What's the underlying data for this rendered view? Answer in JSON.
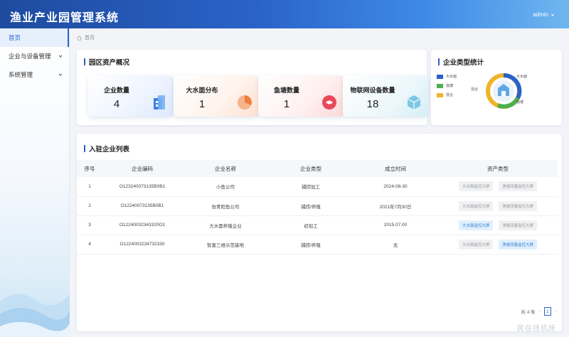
{
  "app": {
    "title": "渔业产业园管理系统",
    "user": "admin"
  },
  "sidebar": {
    "items": [
      {
        "label": "首页"
      },
      {
        "label": "企业与设备管理"
      },
      {
        "label": "系统管理"
      }
    ]
  },
  "breadcrumb": "首页",
  "overview": {
    "title": "园区资产概况",
    "stats": [
      {
        "label": "企业数量",
        "value": "4",
        "icon": "building-icon"
      },
      {
        "label": "大水面分布",
        "value": "1",
        "icon": "pie-icon"
      },
      {
        "label": "鱼塘数量",
        "value": "1",
        "icon": "pond-icon"
      },
      {
        "label": "物联网设备数量",
        "value": "18",
        "icon": "cube-icon"
      }
    ]
  },
  "typeStats": {
    "title": "企业类型统计",
    "legend": [
      {
        "label": "大水面",
        "color": "#2a63c8"
      },
      {
        "label": "渔塘",
        "color": "#4caf50"
      },
      {
        "label": "混合",
        "color": "#f0b429"
      }
    ],
    "labels": {
      "top": "大水面",
      "left": "混合",
      "bottom": "渔塘"
    }
  },
  "enterprises": {
    "title": "入驻企业列表",
    "columns": [
      "序号",
      "企业编码",
      "企业名称",
      "企业类型",
      "成立时间",
      "资产类型"
    ],
    "asset_labels": [
      "大水面监控大屏",
      "渔塘流量监控大屏"
    ],
    "rows": [
      {
        "no": "1",
        "code": "O123240073135B0B1",
        "name": "小鱼公司",
        "type": "捕捞加工",
        "date": "2024-08-30",
        "asset1_active": false,
        "asset2_active": false
      },
      {
        "no": "2",
        "code": "O12240073135B0B1",
        "name": "张青阳鱼公司",
        "type": "捕捞/养殖",
        "date": "2021年7月30日",
        "asset1_active": false,
        "asset2_active": false
      },
      {
        "no": "3",
        "code": "O12240032343320O1",
        "name": "大水面养殖企业",
        "type": "初加工",
        "date": "2015.07.00",
        "asset1_active": true,
        "asset2_active": false
      },
      {
        "no": "4",
        "code": "O1224003234732330",
        "name": "智富三维示范基地",
        "type": "捕捞/养殖",
        "date": "无",
        "asset1_active": false,
        "asset2_active": true
      }
    ]
  },
  "pager": {
    "total": "共 4 条",
    "page": "1"
  },
  "watermark": "民在线机床"
}
